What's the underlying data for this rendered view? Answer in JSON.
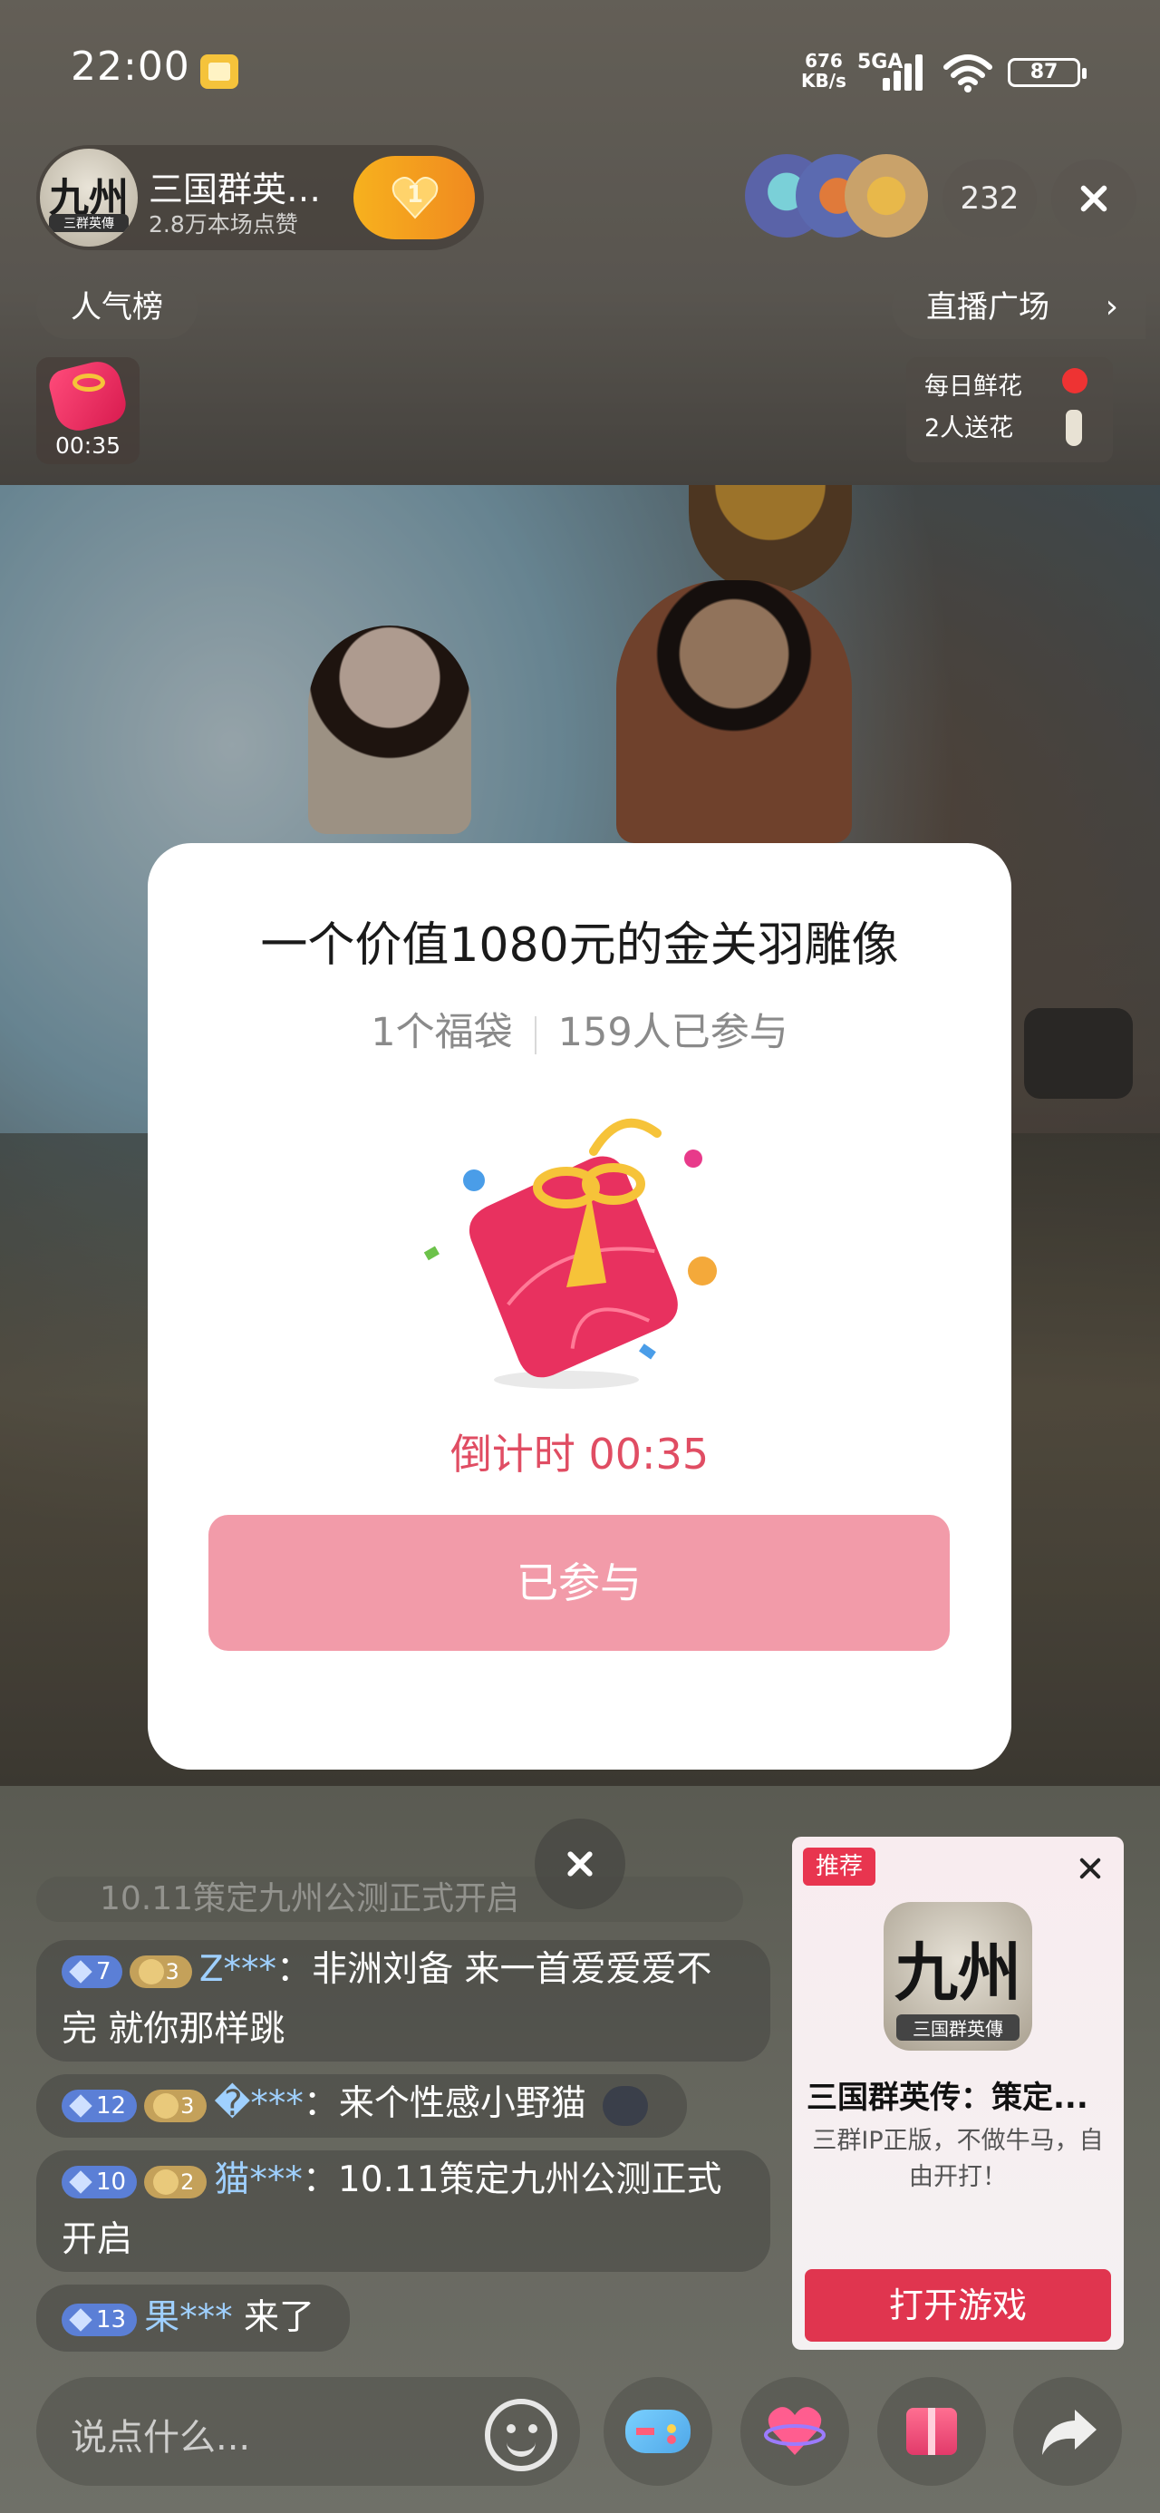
{
  "status_bar": {
    "time": "22:00",
    "net_speed_value": "676",
    "net_speed_unit": "KB/s",
    "network_type": "5GA",
    "battery": "87",
    "icons": [
      "app-notification-icon",
      "signal-icon",
      "wifi-icon",
      "battery-icon"
    ]
  },
  "streamer": {
    "name": "三国群英…",
    "likes": "2.8万本场点赞",
    "avatar_glyph": "九州",
    "avatar_sub": "三群英傳",
    "fan_level": "1"
  },
  "viewers": {
    "count": "232"
  },
  "top_nav": {
    "rank_label": "人气榜",
    "plaza_label": "直播广场",
    "plaza_chevron": "›"
  },
  "lucky_bag_thumb": {
    "countdown": "00:35"
  },
  "flower": {
    "line1": "每日鲜花",
    "line2": "2人送花"
  },
  "modal": {
    "title": "一个价值1080元的金关羽雕像",
    "bag_count": "1个福袋",
    "participants": "159人已参与",
    "countdown": "倒计时 00:35",
    "button_label": "已参与"
  },
  "chat": {
    "faded_text": "10.11策定九州公测正式开启",
    "messages": [
      {
        "level": "7",
        "fan_level": "3",
        "user": "Z***",
        "sep": "：",
        "text": "非洲刘备 来一首爱爱爱不完 就你那样跳"
      },
      {
        "level": "12",
        "fan_level": "3",
        "user": "�***",
        "sep": "：",
        "text": "来个性感小野猫"
      },
      {
        "level": "10",
        "fan_level": "2",
        "user": "猫***",
        "sep": "：",
        "text": "10.11策定九州公测正式开启"
      },
      {
        "level": "13",
        "user": "果***",
        "text": "来了"
      }
    ]
  },
  "game_card": {
    "tag": "推荐",
    "icon_glyph": "九州",
    "icon_sub": "三国群英傳",
    "name": "三国群英传：策定...",
    "desc": "三群IP正版，不做牛马，自由开打！",
    "open_label": "打开游戏"
  },
  "bottom_bar": {
    "input_placeholder": "说点什么..."
  },
  "colors": {
    "accent_pink": "#f29ba9",
    "countdown_red": "#e04d63",
    "tag_red": "#e8354f",
    "level_blue": "#5b7fd6",
    "fan_gold": "#c4a15a"
  }
}
